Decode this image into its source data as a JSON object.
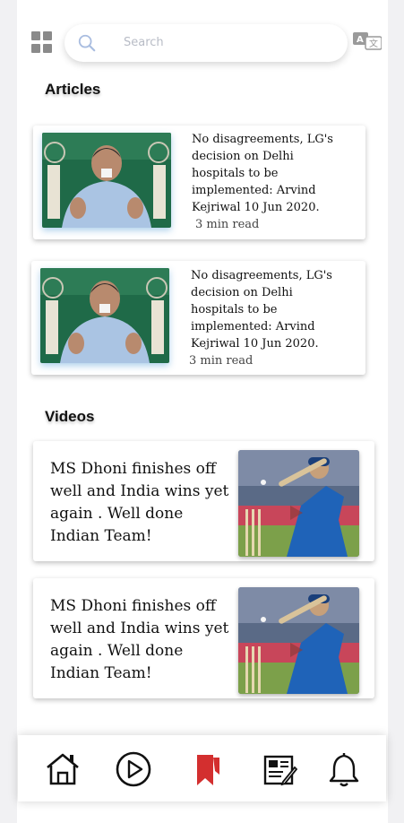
{
  "search": {
    "placeholder": "Search"
  },
  "icons": {
    "menu": "grid-icon",
    "search": "search-icon",
    "translate": "translate-icon",
    "home": "home-icon",
    "play": "play-icon",
    "bookmark": "bookmark-icon",
    "news": "newspaper-icon",
    "notifications": "bell-icon"
  },
  "articles": {
    "title": "Articles",
    "items": [
      {
        "headline": "No disagreements, LG's decision on Delhi hospitals to be implemented: Arvind Kejriwal 10 Jun 2020.",
        "readtime": "3 min read"
      },
      {
        "headline": "No disagreements, LG's decision on Delhi hospitals to be implemented: Arvind Kejriwal 10 Jun 2020.",
        "readtime": "3 min read"
      }
    ]
  },
  "videos": {
    "title": "Videos",
    "items": [
      {
        "caption": "MS Dhoni finishes off well and India wins yet again . Well done Indian Team!"
      },
      {
        "caption": "MS Dhoni finishes off well and India wins yet again . Well done Indian Team!"
      }
    ]
  },
  "colors": {
    "accent": "#d32f2f",
    "background": "#ffffff",
    "page": "#f1f1f3"
  }
}
